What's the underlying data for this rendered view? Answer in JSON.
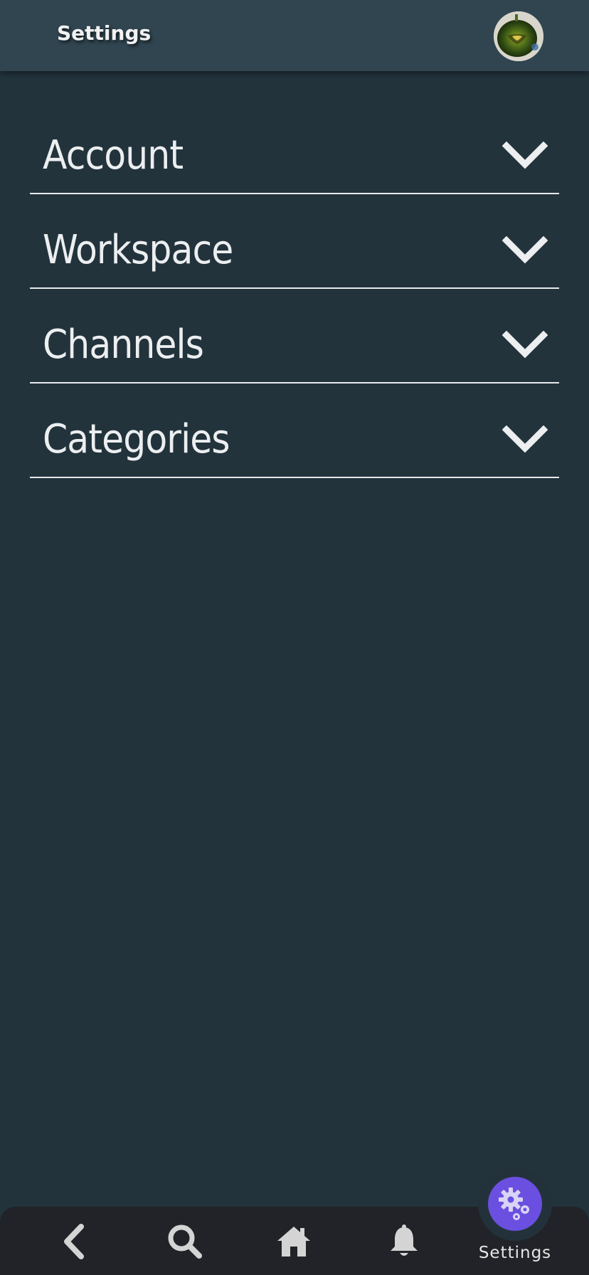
{
  "header": {
    "title": "Settings",
    "avatar_icon": "kiwi-avatar"
  },
  "sections": [
    {
      "label": "Account",
      "expanded": false
    },
    {
      "label": "Workspace",
      "expanded": false
    },
    {
      "label": "Channels",
      "expanded": false
    },
    {
      "label": "Categories",
      "expanded": false
    }
  ],
  "bottom_nav": {
    "items": [
      {
        "icon": "back-arrow-icon"
      },
      {
        "icon": "search-icon"
      },
      {
        "icon": "home-icon"
      },
      {
        "icon": "bell-icon"
      }
    ],
    "active": {
      "icon": "gears-icon",
      "label": "Settings"
    }
  },
  "colors": {
    "background": "#22333c",
    "header": "#304550",
    "nav": "#212328",
    "accent": "#6a4fe0",
    "text": "#eceef0"
  }
}
